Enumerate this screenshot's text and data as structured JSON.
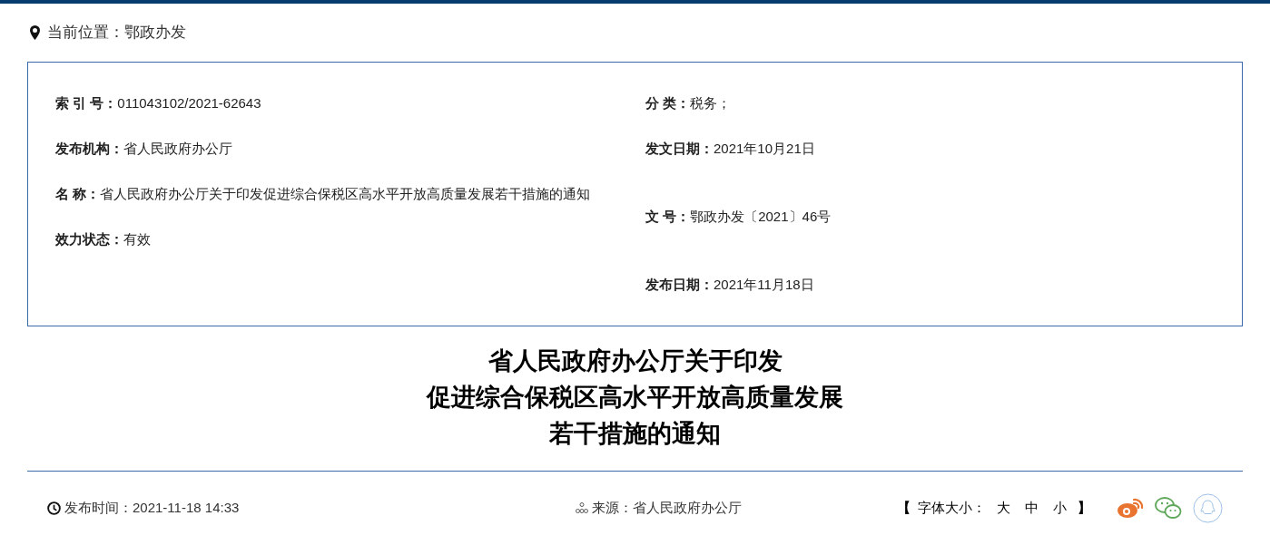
{
  "breadcrumb": {
    "label": "当前位置：",
    "value": "鄂政办发"
  },
  "meta": {
    "left": [
      {
        "label": "索 引 号：",
        "value": "011043102/2021-62643"
      },
      {
        "label": "发布机构：",
        "value": "省人民政府办公厅"
      },
      {
        "label": "名 称：",
        "value": "省人民政府办公厅关于印发促进综合保税区高水平开放高质量发展若干措施的通知"
      },
      {
        "label": "效力状态：",
        "value": "有效"
      }
    ],
    "right": [
      {
        "label": "分 类：",
        "value": "税务；"
      },
      {
        "label": "发文日期：",
        "value": "2021年10月21日"
      },
      {
        "label": "文 号：",
        "value": "鄂政办发〔2021〕46号"
      },
      {
        "label": "发布日期：",
        "value": "2021年11月18日"
      }
    ]
  },
  "title_lines": [
    "省人民政府办公厅关于印发",
    "促进综合保税区高水平开放高质量发展",
    "若干措施的通知"
  ],
  "footer": {
    "publish_time": "发布时间：2021-11-18 14:33",
    "source": "来源：省人民政府办公厅",
    "font_size": {
      "open": "【",
      "label": "字体大小：",
      "options": [
        "大",
        "中",
        "小"
      ],
      "close": "】"
    }
  }
}
